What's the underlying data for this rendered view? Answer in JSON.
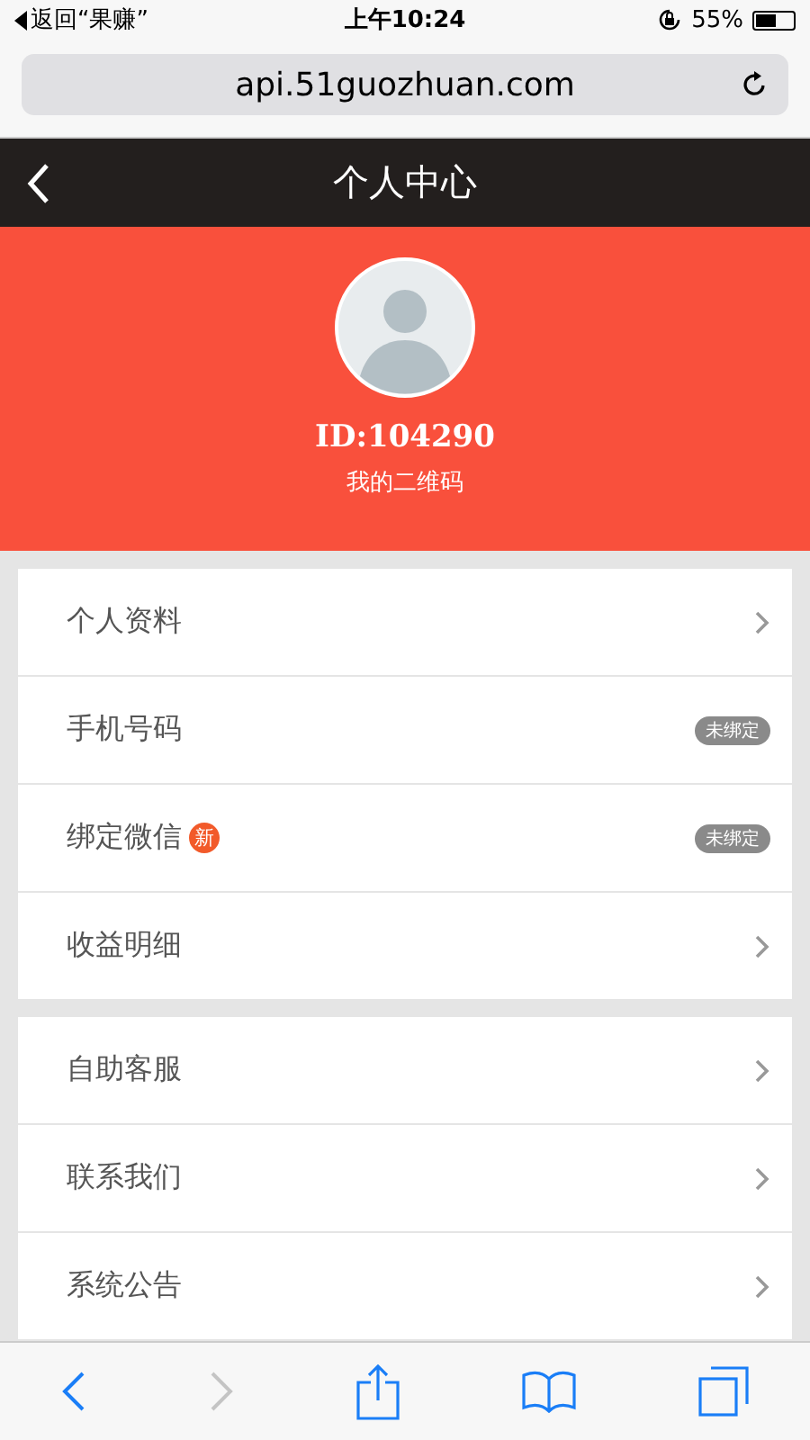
{
  "status_bar": {
    "back_app": "返回“果赚”",
    "time": "上午10:24",
    "battery": "55%"
  },
  "address_bar": {
    "url": "api.51guozhuan.com"
  },
  "nav_bar": {
    "title": "个人中心"
  },
  "profile": {
    "user_id": "ID:104290",
    "qr_link": "我的二维码"
  },
  "menu_groups": [
    {
      "items": [
        {
          "label": "个人资料",
          "kind": "arrow"
        },
        {
          "label": "手机号码",
          "kind": "tag",
          "tag": "未绑定"
        },
        {
          "label": "绑定微信",
          "kind": "tag",
          "tag": "未绑定",
          "badge": "新"
        },
        {
          "label": "收益明细",
          "kind": "arrow"
        }
      ]
    },
    {
      "items": [
        {
          "label": "自助客服",
          "kind": "arrow"
        },
        {
          "label": "联系我们",
          "kind": "arrow"
        },
        {
          "label": "系统公告",
          "kind": "arrow"
        }
      ]
    }
  ],
  "toolbar": {
    "back_disabled": false,
    "forward_disabled": true
  }
}
